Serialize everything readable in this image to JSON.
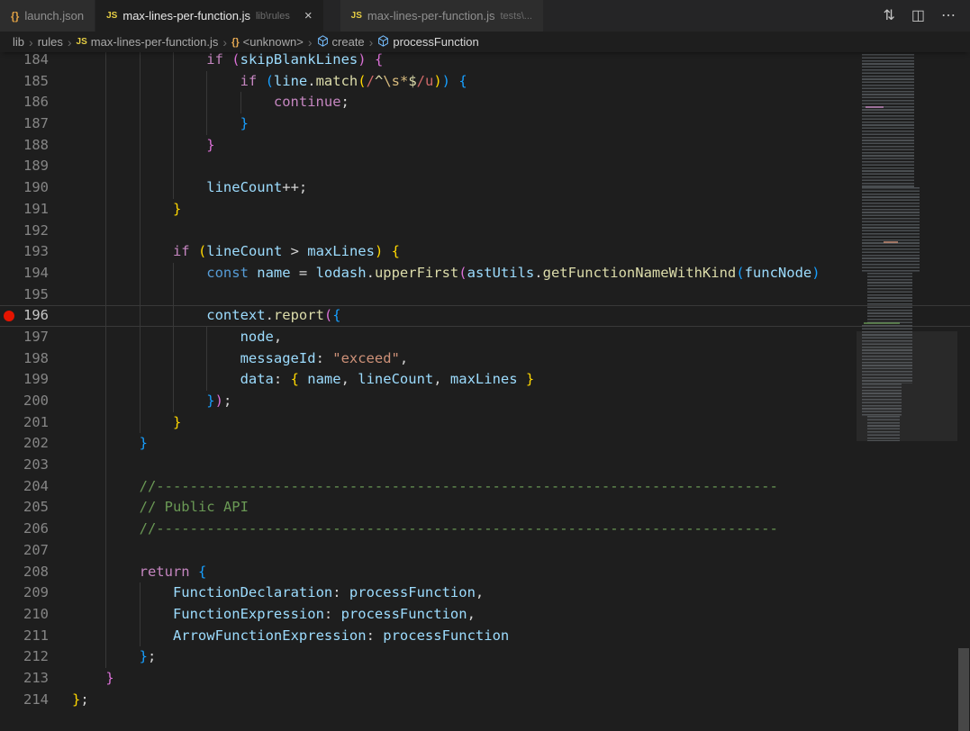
{
  "colors": {
    "breakpoint_red": "#e51400",
    "accent_keyword": "#C586C0",
    "accent_string": "#CE9178",
    "accent_comment": "#6A9955"
  },
  "tabs": [
    {
      "label": "launch.json",
      "icon": "json",
      "desc": "",
      "active": false
    },
    {
      "label": "max-lines-per-function.js",
      "icon": "js",
      "desc": "lib\\rules",
      "active": true,
      "close_glyph": "×"
    },
    {
      "label": "max-lines-per-function.js",
      "icon": "js",
      "desc": "tests\\...",
      "active": false
    }
  ],
  "editor_actions": [
    {
      "name": "open-changes-icon",
      "glyph": "⇅"
    },
    {
      "name": "split-editor-icon",
      "glyph": "◫"
    },
    {
      "name": "more-actions-icon",
      "glyph": "⋯"
    }
  ],
  "breadcrumb": {
    "separator": "›",
    "items": [
      {
        "label": "lib",
        "icon": null
      },
      {
        "label": "rules",
        "icon": null
      },
      {
        "label": "max-lines-per-function.js",
        "icon": "js"
      },
      {
        "label": "<unknown>",
        "icon": "object"
      },
      {
        "label": "create",
        "icon": "symbol"
      },
      {
        "label": "processFunction",
        "icon": "symbol"
      }
    ]
  },
  "code": {
    "lines": [
      {
        "no": 184,
        "indent": 4,
        "tokens": [
          [
            "kw",
            "if"
          ],
          [
            "pun",
            " "
          ],
          [
            "b2",
            "("
          ],
          [
            "var",
            "skipBlankLines"
          ],
          [
            "b2",
            ")"
          ],
          [
            "pun",
            " "
          ],
          [
            "b2",
            "{"
          ]
        ]
      },
      {
        "no": 185,
        "indent": 5,
        "tokens": [
          [
            "kw",
            "if"
          ],
          [
            "pun",
            " "
          ],
          [
            "b3",
            "("
          ],
          [
            "var",
            "line"
          ],
          [
            "pun",
            "."
          ],
          [
            "fn",
            "match"
          ],
          [
            "b1",
            "("
          ],
          [
            "rx",
            "/"
          ],
          [
            "rxa",
            "^"
          ],
          [
            "rxe",
            "\\s"
          ],
          [
            "rxe",
            "*"
          ],
          [
            "rxa",
            "$"
          ],
          [
            "rx",
            "/u"
          ],
          [
            "b1",
            ")"
          ],
          [
            "b3",
            ")"
          ],
          [
            "pun",
            " "
          ],
          [
            "b3",
            "{"
          ]
        ]
      },
      {
        "no": 186,
        "indent": 6,
        "tokens": [
          [
            "kw",
            "continue"
          ],
          [
            "pun",
            ";"
          ]
        ]
      },
      {
        "no": 187,
        "indent": 5,
        "tokens": [
          [
            "b3",
            "}"
          ]
        ]
      },
      {
        "no": 188,
        "indent": 4,
        "tokens": [
          [
            "b2",
            "}"
          ]
        ]
      },
      {
        "no": 189,
        "indent": 4,
        "tokens": []
      },
      {
        "no": 190,
        "indent": 4,
        "tokens": [
          [
            "var",
            "lineCount"
          ],
          [
            "pun",
            "++;"
          ]
        ]
      },
      {
        "no": 191,
        "indent": 3,
        "tokens": [
          [
            "b1",
            "}"
          ]
        ]
      },
      {
        "no": 192,
        "indent": 3,
        "tokens": []
      },
      {
        "no": 193,
        "indent": 3,
        "tokens": [
          [
            "kw",
            "if"
          ],
          [
            "pun",
            " "
          ],
          [
            "b1",
            "("
          ],
          [
            "var",
            "lineCount"
          ],
          [
            "pun",
            " > "
          ],
          [
            "var",
            "maxLines"
          ],
          [
            "b1",
            ")"
          ],
          [
            "pun",
            " "
          ],
          [
            "b1",
            "{"
          ]
        ]
      },
      {
        "no": 194,
        "indent": 4,
        "tokens": [
          [
            "kw2",
            "const"
          ],
          [
            "pun",
            " "
          ],
          [
            "var",
            "name"
          ],
          [
            "pun",
            " = "
          ],
          [
            "var",
            "lodash"
          ],
          [
            "pun",
            "."
          ],
          [
            "fn",
            "upperFirst"
          ],
          [
            "b2",
            "("
          ],
          [
            "var",
            "astUtils"
          ],
          [
            "pun",
            "."
          ],
          [
            "fn",
            "getFunctionNameWithKind"
          ],
          [
            "b3",
            "("
          ],
          [
            "var",
            "funcNode"
          ],
          [
            "b3",
            ")"
          ]
        ]
      },
      {
        "no": 195,
        "indent": 4,
        "tokens": []
      },
      {
        "no": 196,
        "indent": 4,
        "breakpoint": true,
        "current": true,
        "tokens": [
          [
            "var",
            "context"
          ],
          [
            "pun",
            "."
          ],
          [
            "fn",
            "report"
          ],
          [
            "b2",
            "("
          ],
          [
            "b3",
            "{"
          ]
        ]
      },
      {
        "no": 197,
        "indent": 5,
        "tokens": [
          [
            "var",
            "node"
          ],
          [
            "pun",
            ","
          ]
        ]
      },
      {
        "no": 198,
        "indent": 5,
        "tokens": [
          [
            "var",
            "messageId"
          ],
          [
            "pun",
            ": "
          ],
          [
            "str",
            "\"exceed\""
          ],
          [
            "pun",
            ","
          ]
        ]
      },
      {
        "no": 199,
        "indent": 5,
        "tokens": [
          [
            "var",
            "data"
          ],
          [
            "pun",
            ": "
          ],
          [
            "b1",
            "{"
          ],
          [
            "pun",
            " "
          ],
          [
            "var",
            "name"
          ],
          [
            "pun",
            ", "
          ],
          [
            "var",
            "lineCount"
          ],
          [
            "pun",
            ", "
          ],
          [
            "var",
            "maxLines"
          ],
          [
            "pun",
            " "
          ],
          [
            "b1",
            "}"
          ]
        ]
      },
      {
        "no": 200,
        "indent": 4,
        "tokens": [
          [
            "b3",
            "}"
          ],
          [
            "b2",
            ")"
          ],
          [
            "pun",
            ";"
          ]
        ]
      },
      {
        "no": 201,
        "indent": 3,
        "tokens": [
          [
            "b1",
            "}"
          ]
        ]
      },
      {
        "no": 202,
        "indent": 2,
        "tokens": [
          [
            "b3",
            "}"
          ]
        ]
      },
      {
        "no": 203,
        "indent": 2,
        "tokens": []
      },
      {
        "no": 204,
        "indent": 2,
        "tokens": [
          [
            "cmt",
            "//--------------------------------------------------------------------------"
          ]
        ]
      },
      {
        "no": 205,
        "indent": 2,
        "tokens": [
          [
            "cmt",
            "// Public API"
          ]
        ]
      },
      {
        "no": 206,
        "indent": 2,
        "tokens": [
          [
            "cmt",
            "//--------------------------------------------------------------------------"
          ]
        ]
      },
      {
        "no": 207,
        "indent": 2,
        "tokens": []
      },
      {
        "no": 208,
        "indent": 2,
        "tokens": [
          [
            "kw",
            "return"
          ],
          [
            "pun",
            " "
          ],
          [
            "b3",
            "{"
          ]
        ]
      },
      {
        "no": 209,
        "indent": 3,
        "tokens": [
          [
            "var",
            "FunctionDeclaration"
          ],
          [
            "pun",
            ": "
          ],
          [
            "var",
            "processFunction"
          ],
          [
            "pun",
            ","
          ]
        ]
      },
      {
        "no": 210,
        "indent": 3,
        "tokens": [
          [
            "var",
            "FunctionExpression"
          ],
          [
            "pun",
            ": "
          ],
          [
            "var",
            "processFunction"
          ],
          [
            "pun",
            ","
          ]
        ]
      },
      {
        "no": 211,
        "indent": 3,
        "tokens": [
          [
            "var",
            "ArrowFunctionExpression"
          ],
          [
            "pun",
            ": "
          ],
          [
            "var",
            "processFunction"
          ]
        ]
      },
      {
        "no": 212,
        "indent": 2,
        "tokens": [
          [
            "b3",
            "}"
          ],
          [
            "pun",
            ";"
          ]
        ]
      },
      {
        "no": 213,
        "indent": 1,
        "tokens": [
          [
            "b2",
            "}"
          ]
        ]
      },
      {
        "no": 214,
        "indent": 0,
        "tokens": [
          [
            "b1",
            "}"
          ],
          [
            "pun",
            ";"
          ]
        ]
      }
    ]
  }
}
